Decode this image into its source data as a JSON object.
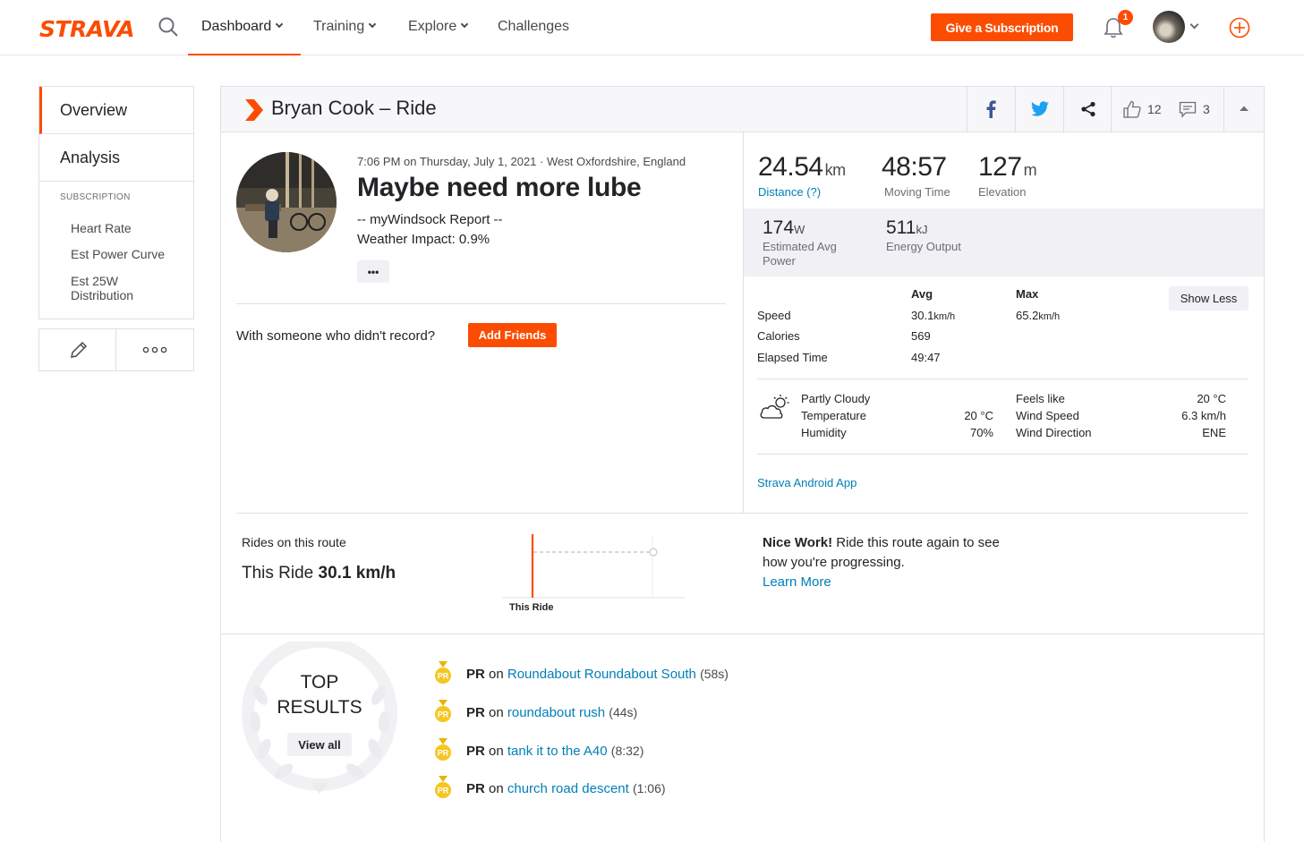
{
  "nav": {
    "logo": "STRAVA",
    "items": [
      {
        "label": "Dashboard",
        "dropdown": true,
        "active": true
      },
      {
        "label": "Training",
        "dropdown": true,
        "active": false
      },
      {
        "label": "Explore",
        "dropdown": true,
        "active": false
      },
      {
        "label": "Challenges",
        "dropdown": false,
        "active": false
      }
    ],
    "give_subscription": "Give a Subscription",
    "notification_count": "1",
    "accent_color": "#fc4c02"
  },
  "sidebar": {
    "tabs": [
      "Overview",
      "Analysis"
    ],
    "subscription_heading": "SUBSCRIPTION",
    "links": [
      "Heart Rate",
      "Est Power Curve",
      "Est 25W Distribution"
    ],
    "actions": [
      "edit-icon",
      "more-icon"
    ]
  },
  "activity": {
    "header_title": "Bryan Cook – Ride",
    "kudos_count": "12",
    "comments_count": "3",
    "datetime_location": "7:06 PM on Thursday, July 1, 2021 · West Oxfordshire, England",
    "title": "Maybe need more lube",
    "description_line1": "-- myWindsock Report --",
    "description_line2": "Weather Impact: 0.9%",
    "more_button": "•••",
    "with_someone": "With someone who didn't record?",
    "add_friends": "Add Friends"
  },
  "stats": {
    "distance": {
      "value": "24.54",
      "unit": "km",
      "label": "Distance (?)"
    },
    "moving_time": {
      "value": "48:57",
      "label": "Moving Time"
    },
    "elevation": {
      "value": "127",
      "unit": "m",
      "label": "Elevation"
    },
    "avg_power": {
      "value": "174",
      "unit": "W",
      "label": "Estimated Avg Power"
    },
    "energy": {
      "value": "511",
      "unit": "kJ",
      "label": "Energy Output"
    },
    "table_headers": {
      "avg": "Avg",
      "max": "Max"
    },
    "show_less": "Show Less",
    "rows": [
      {
        "label": "Speed",
        "avg": "30.1",
        "avg_unit": "km/h",
        "max": "65.2",
        "max_unit": "km/h"
      },
      {
        "label": "Calories",
        "avg": "569",
        "avg_unit": "",
        "max": "",
        "max_unit": ""
      },
      {
        "label": "Elapsed Time",
        "avg": "49:47",
        "avg_unit": "",
        "max": "",
        "max_unit": ""
      }
    ],
    "weather": {
      "condition": "Partly Cloudy",
      "temperature_label": "Temperature",
      "temperature": "20 °C",
      "humidity_label": "Humidity",
      "humidity": "70%",
      "feels_like_label": "Feels like",
      "feels_like": "20 °C",
      "wind_speed_label": "Wind Speed",
      "wind_speed": "6.3 km/h",
      "wind_direction_label": "Wind Direction",
      "wind_direction": "ENE"
    },
    "device": "Strava Android App"
  },
  "route": {
    "label": "Rides on this route",
    "this_ride_prefix": "This Ride",
    "this_ride_speed": "30.1 km/h",
    "chart_label": "This Ride",
    "nice_work_bold": "Nice Work!",
    "nice_work_text": " Ride this route again to see how you're progressing.",
    "learn_more": "Learn More"
  },
  "top_results": {
    "title_line1": "TOP",
    "title_line2": "RESULTS",
    "view_all": "View all",
    "items": [
      {
        "badge": "PR",
        "prefix": "PR",
        "on": "on",
        "segment": "Roundabout Roundabout South",
        "time": "(58s)"
      },
      {
        "badge": "PR",
        "prefix": "PR",
        "on": "on",
        "segment": "roundabout rush",
        "time": "(44s)"
      },
      {
        "badge": "PR",
        "prefix": "PR",
        "on": "on",
        "segment": "tank it to the A40",
        "time": "(8:32)"
      },
      {
        "badge": "PR",
        "prefix": "PR",
        "on": "on",
        "segment": "church road descent",
        "time": "(1:06)"
      }
    ]
  }
}
